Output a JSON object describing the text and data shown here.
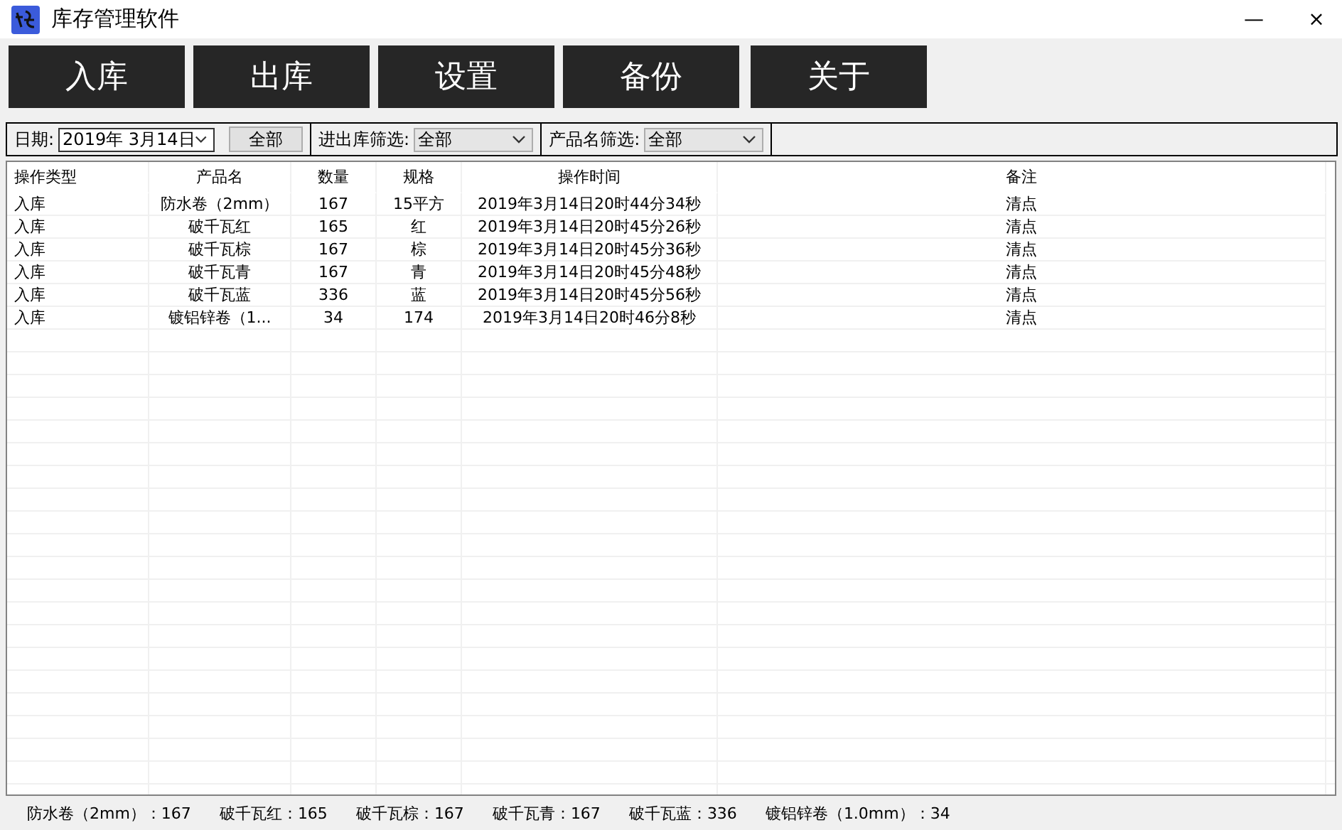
{
  "window": {
    "title": "库存管理软件",
    "controls": [
      "—",
      "×"
    ]
  },
  "toolbar": [
    "入库",
    "出库",
    "设置",
    "备份",
    "关于"
  ],
  "filters": {
    "date_label": "日期:",
    "date_value": "2019年  3月14日",
    "all_button": "全部",
    "type_label": "进出库筛选:",
    "type_value": "全部",
    "product_label": "产品名筛选:",
    "product_value": "全部"
  },
  "table": {
    "columns": [
      "操作类型",
      "产品名",
      "数量",
      "规格",
      "操作时间",
      "备注"
    ],
    "rows": [
      [
        "入库",
        "防水卷（2mm）",
        "167",
        "15平方",
        "2019年3月14日20时44分34秒",
        "清点"
      ],
      [
        "入库",
        "破千瓦红",
        "165",
        "红",
        "2019年3月14日20时45分26秒",
        "清点"
      ],
      [
        "入库",
        "破千瓦棕",
        "167",
        "棕",
        "2019年3月14日20时45分36秒",
        "清点"
      ],
      [
        "入库",
        "破千瓦青",
        "167",
        "青",
        "2019年3月14日20时45分48秒",
        "清点"
      ],
      [
        "入库",
        "破千瓦蓝",
        "336",
        "蓝",
        "2019年3月14日20时45分56秒",
        "清点"
      ],
      [
        "入库",
        "镀铝锌卷（1...",
        "34",
        "174",
        "2019年3月14日20时46分8秒",
        "清点"
      ]
    ]
  },
  "status_bar": [
    "防水卷（2mm）：167",
    "破千瓦红：165",
    "破千瓦棕：167",
    "破千瓦青：167",
    "破千瓦蓝：336",
    "镀铝锌卷（1.0mm）：34"
  ]
}
